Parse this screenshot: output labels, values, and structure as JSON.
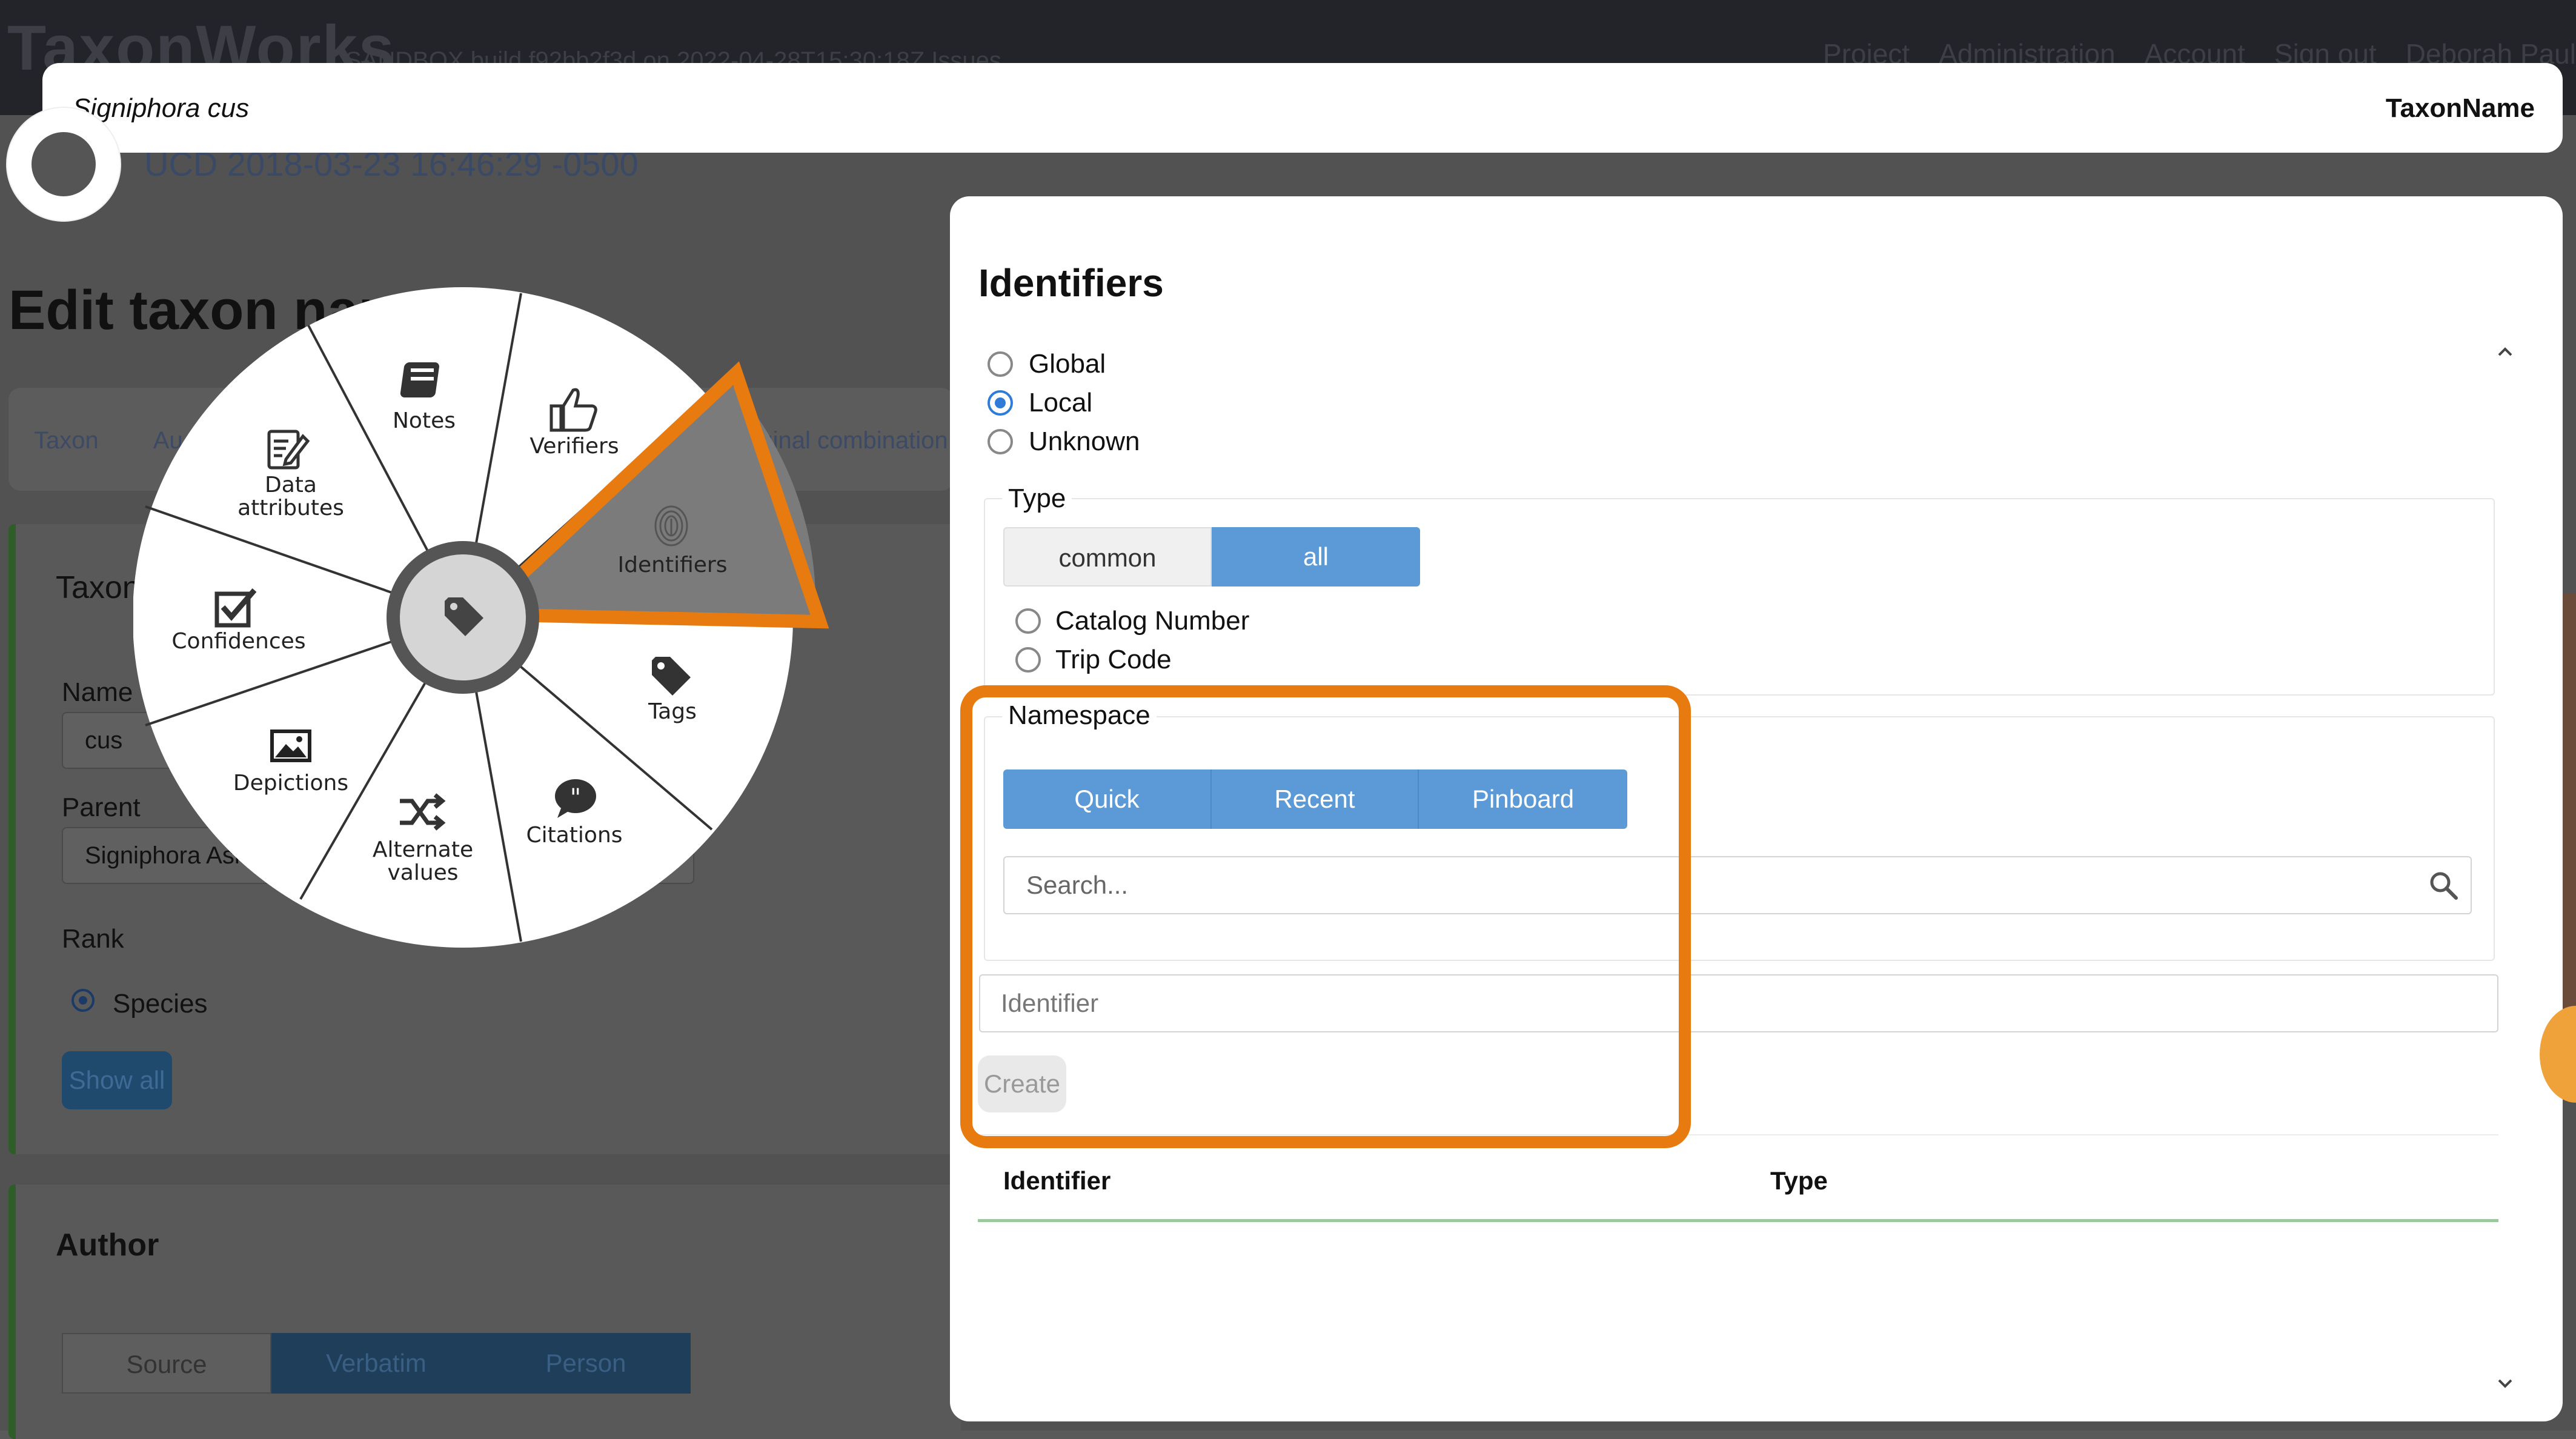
{
  "background": {
    "app_name": "TaxonWorks",
    "env_info": "SANDBOX   build f92bb2f3d on 2022-04-28T15:30:18Z   Issues",
    "nav": [
      "Project",
      "Administration",
      "Account",
      "Sign out",
      "Deborah Paul"
    ],
    "timestamp": "UCD 2018-03-23 16:46:29 -0500",
    "page_title": "Edit taxon name",
    "tabs": [
      "Taxon",
      "Au"
    ],
    "tab_original_combination": "Original combination",
    "card_title": "Taxon",
    "name_label": "Name",
    "name_value": "cus",
    "parent_label": "Parent",
    "parent_value": "Signiphora Ashmead",
    "rank_label": "Rank",
    "rank_value": "Species",
    "show_all_label": "Show all",
    "author_label": "Author",
    "author_tabs": [
      "Source",
      "Verbatim",
      "Person"
    ]
  },
  "titlebar": {
    "taxon_name": "Signiphora cus",
    "object_type": "TaxonName"
  },
  "radial_menu": {
    "center_icon": "tag-icon",
    "items": [
      {
        "label": "Notes",
        "icon": "notebook-icon"
      },
      {
        "label": "Verifiers",
        "icon": "thumbs-up-icon"
      },
      {
        "label": "Identifiers",
        "icon": "fingerprint-icon",
        "active": true
      },
      {
        "label": "Tags",
        "icon": "tag-icon"
      },
      {
        "label": "Citations",
        "icon": "quote-bubble-icon"
      },
      {
        "label": "Alternate values",
        "label_line1": "Alternate",
        "label_line2": "values",
        "icon": "shuffle-icon"
      },
      {
        "label": "Depictions",
        "icon": "image-icon"
      },
      {
        "label": "Confidences",
        "icon": "checkbox-icon"
      },
      {
        "label": "Data attributes",
        "label_line1": "Data",
        "label_line2": "attributes",
        "icon": "edit-document-icon"
      }
    ]
  },
  "modal": {
    "title": "Identifiers",
    "scope_options": [
      {
        "label": "Global",
        "checked": false
      },
      {
        "label": "Local",
        "checked": true
      },
      {
        "label": "Unknown",
        "checked": false
      }
    ],
    "type_legend": "Type",
    "type_toggle": [
      {
        "label": "common",
        "active": false
      },
      {
        "label": "all",
        "active": true
      }
    ],
    "type_options": [
      {
        "label": "Catalog Number",
        "checked": false
      },
      {
        "label": "Trip Code",
        "checked": false
      }
    ],
    "namespace_legend": "Namespace",
    "namespace_tabs": [
      "Quick",
      "Recent",
      "Pinboard"
    ],
    "search_placeholder": "Search...",
    "identifier_placeholder": "Identifier",
    "create_label": "Create",
    "table_headers": [
      "Identifier",
      "Type"
    ]
  },
  "colors": {
    "accent_blue": "#5b9ad6",
    "highlight_orange": "#e87b10",
    "radio_blue": "#2f7bd8"
  }
}
